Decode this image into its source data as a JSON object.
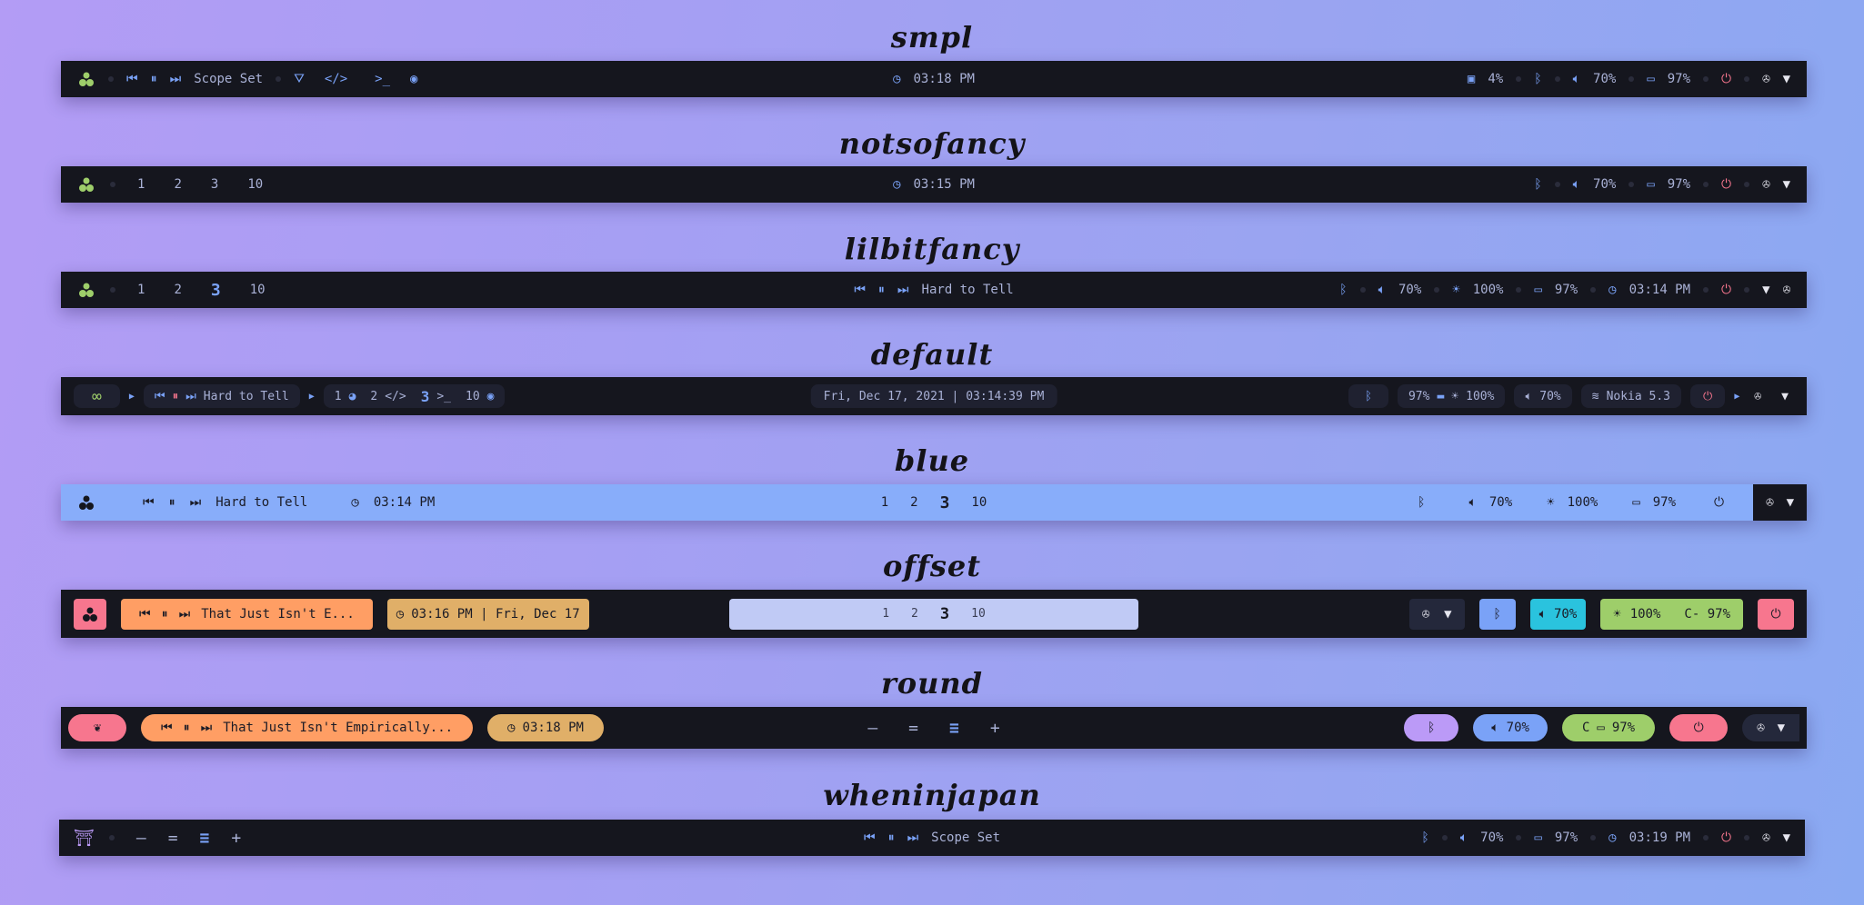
{
  "titles": {
    "t1": "smpl",
    "t2": "notsofancy",
    "t3": "lilbitfancy",
    "t4": "default",
    "t5": "blue",
    "t6": "offset",
    "t7": "round",
    "t8": "wheninjapan"
  },
  "bar1": {
    "media": "Scope Set",
    "clock": "03:18 PM",
    "cpu": "4%",
    "volume": "70%",
    "battery": "97%"
  },
  "bar2": {
    "workspaces": [
      "1",
      "2",
      "3",
      "10"
    ],
    "clock": "03:15 PM",
    "volume": "70%",
    "battery": "97%"
  },
  "bar3": {
    "workspaces": [
      "1",
      "2",
      "3",
      "10"
    ],
    "media": "Hard to Tell",
    "volume": "70%",
    "brightness": "100%",
    "battery": "97%",
    "clock": "03:14 PM"
  },
  "bar4": {
    "media": "Hard to Tell",
    "workspaces": [
      "1",
      "2",
      "3",
      "10"
    ],
    "datetime": "Fri, Dec 17, 2021 | 03:14:39 PM",
    "battery": "97%",
    "brightness": "100%",
    "volume": "70%",
    "network": "Nokia 5.3"
  },
  "bar5": {
    "media": "Hard to Tell",
    "clock": "03:14 PM",
    "workspaces": [
      "1",
      "2",
      "3",
      "10"
    ],
    "volume": "70%",
    "brightness": "100%",
    "battery": "97%"
  },
  "bar6": {
    "media": "That Just Isn't E...",
    "datetime": "03:16 PM | Fri, Dec 17",
    "workspaces": [
      "1",
      "2",
      "3",
      "10"
    ],
    "volume": "70%",
    "brightness": "100%",
    "battery": "C- 97%"
  },
  "bar7": {
    "media": "That Just Isn't Empirically...",
    "clock": "03:18 PM",
    "volume": "70%",
    "battery_prefix": "C",
    "battery": "97%"
  },
  "bar8": {
    "media": "Scope Set",
    "volume": "70%",
    "battery": "97%",
    "clock": "03:19 PM"
  },
  "colors": {
    "bar": "#15161e",
    "accent": "#7aa2f7",
    "green": "#9ece6a",
    "red": "#f7768e",
    "orange": "#ff9e64",
    "yellow": "#e0af68",
    "cyan": "#2ac3de",
    "purple": "#bb9af7",
    "offset_ws": "#c0caf5",
    "blue_bar": "#88adfa"
  }
}
